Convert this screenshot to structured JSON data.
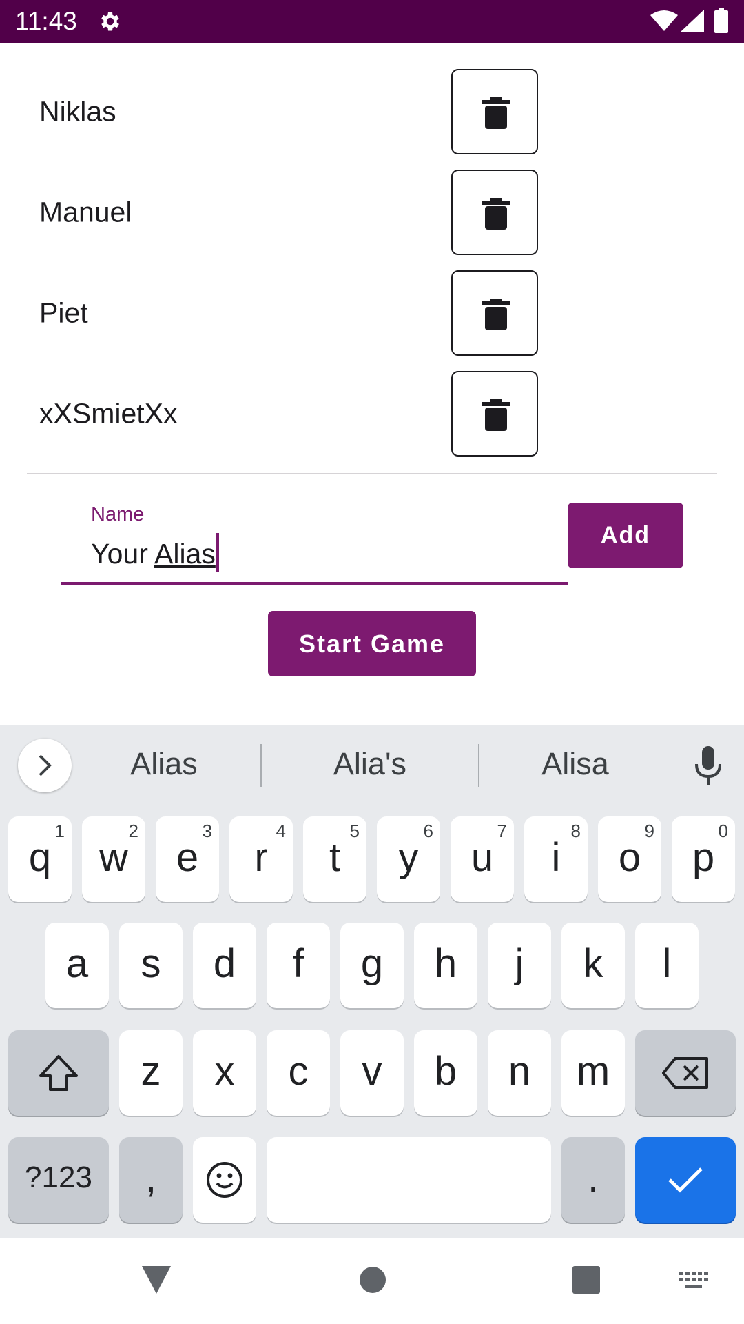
{
  "status_bar": {
    "time": "11:43",
    "icons": [
      "gear-icon",
      "wifi-icon",
      "cell-signal-icon",
      "battery-icon"
    ],
    "background": "#510049"
  },
  "players": [
    {
      "name": "Niklas"
    },
    {
      "name": "Manuel"
    },
    {
      "name": "Piet"
    },
    {
      "name": "xXSmietXx"
    }
  ],
  "name_field": {
    "label": "Name",
    "value_plain": "Your ",
    "value_underlined": "Alias"
  },
  "buttons": {
    "add": "Add",
    "start_game": "Start Game",
    "accent": "#7d1a70"
  },
  "keyboard": {
    "suggestions": [
      "Alias",
      "Alia's",
      "Alisa"
    ],
    "row1": [
      {
        "key": "q",
        "hint": "1"
      },
      {
        "key": "w",
        "hint": "2"
      },
      {
        "key": "e",
        "hint": "3"
      },
      {
        "key": "r",
        "hint": "4"
      },
      {
        "key": "t",
        "hint": "5"
      },
      {
        "key": "y",
        "hint": "6"
      },
      {
        "key": "u",
        "hint": "7"
      },
      {
        "key": "i",
        "hint": "8"
      },
      {
        "key": "o",
        "hint": "9"
      },
      {
        "key": "p",
        "hint": "0"
      }
    ],
    "row2": [
      "a",
      "s",
      "d",
      "f",
      "g",
      "h",
      "j",
      "k",
      "l"
    ],
    "row3": [
      "z",
      "x",
      "c",
      "v",
      "b",
      "n",
      "m"
    ],
    "symbols_key": "?123",
    "comma_key": ",",
    "period_key": ".",
    "enter_color": "#1a73e8"
  },
  "nav_bar": {
    "icons": [
      "back-icon",
      "home-icon",
      "recents-icon",
      "keyboard-switch-icon"
    ]
  }
}
